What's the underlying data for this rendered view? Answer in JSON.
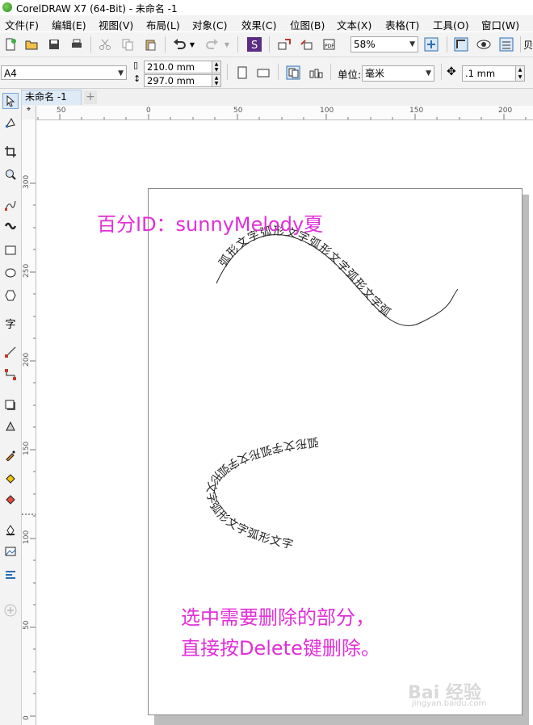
{
  "window": {
    "title": "CorelDRAW X7 (64-Bit) - 未命名 -1"
  },
  "menubar": {
    "items": [
      "文件(F)",
      "编辑(E)",
      "视图(V)",
      "布局(L)",
      "对象(C)",
      "效果(C)",
      "位图(B)",
      "文本(X)",
      "表格(T)",
      "工具(O)",
      "窗口(W)"
    ]
  },
  "toolbar": {
    "zoom_value": "58%",
    "icons": [
      "new-icon",
      "open-icon",
      "save-icon",
      "print-icon",
      "cut-icon",
      "copy-icon",
      "paste-icon",
      "undo-icon",
      "redo-icon",
      "search-content-icon",
      "import-icon",
      "export-icon",
      "publish-pdf-icon",
      "zoom-fit-icon",
      "snap-icon",
      "view-icon",
      "options-icon"
    ]
  },
  "property_bar": {
    "paper_size": "A4",
    "width": "210.0 mm",
    "height": "297.0 mm",
    "units_label": "单位:",
    "units_value": "毫米",
    "nudge_value": ".1 mm"
  },
  "tabs": {
    "document": "未命名 -1",
    "add": "+"
  },
  "rulers": {
    "horizontal": [
      "50",
      "0",
      "50",
      "100",
      "150",
      "200"
    ],
    "vertical": [
      "300",
      "250",
      "200",
      "150",
      "100",
      "50",
      "0"
    ]
  },
  "canvas": {
    "annotation_top": "百分ID：sunnyMelody夏",
    "wave_text": "弧形文字弧形文字弧形文字弧形文字弧",
    "arc_text": "弧形文字弧形文字弧形文字弧形文字弧形文字",
    "instruction_line1": "选中需要删除的部分，",
    "instruction_line2": "直接按Delete键删除。",
    "accent_color": "#e22fd8"
  },
  "watermark": {
    "brand": "Bai  经验",
    "url": "jingyan.baidu.com"
  }
}
